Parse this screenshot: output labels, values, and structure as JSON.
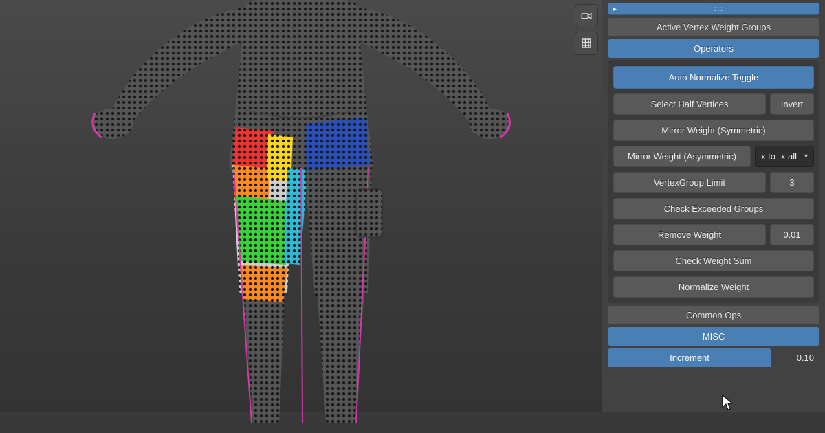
{
  "viewport": {
    "overlay_icons": [
      "camera",
      "shading-grid"
    ]
  },
  "top_bar": {
    "expand_glyph": "▸",
    "grip": "::::"
  },
  "headers": {
    "active_vgroups": "Active Vertex Weight Groups",
    "operators": "Operators",
    "common_ops": "Common Ops",
    "misc": "MISC"
  },
  "ops": {
    "auto_normalize": "Auto Normalize Toggle",
    "select_half": "Select Half Vertices",
    "invert": "Invert",
    "mirror_sym": "Mirror Weight (Symmetric)",
    "mirror_asym": "Mirror Weight (Asymmetric)",
    "mirror_axis_selected": "x to -x all",
    "vg_limit": "VertexGroup Limit",
    "vg_limit_value": "3",
    "check_exceed": "Check Exceeded Groups",
    "remove_weight": "Remove Weight",
    "remove_weight_value": "0.01",
    "check_sum": "Check Weight Sum",
    "normalize": "Normalize Weight"
  },
  "footer": {
    "increment_label": "Increment",
    "increment_value": "0.10"
  }
}
